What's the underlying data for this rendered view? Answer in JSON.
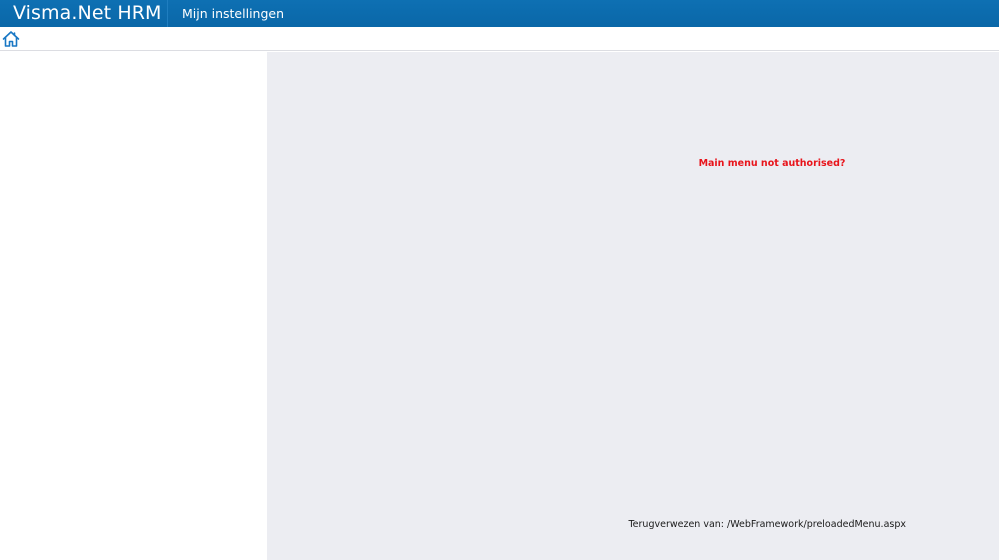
{
  "header": {
    "brand": "Visma.Net HRM",
    "nav_settings": "Mijn instellingen"
  },
  "toolbar": {
    "home_icon": "home-icon"
  },
  "content": {
    "error_message": "Main menu not authorised?",
    "redirect_text": "Terugverwezen van: /WebFramework/preloadedMenu.aspx"
  },
  "colors": {
    "header_bg": "#0a67a8",
    "content_bg": "#ecedf2",
    "error_text": "#e8141b",
    "icon": "#1877c4"
  }
}
